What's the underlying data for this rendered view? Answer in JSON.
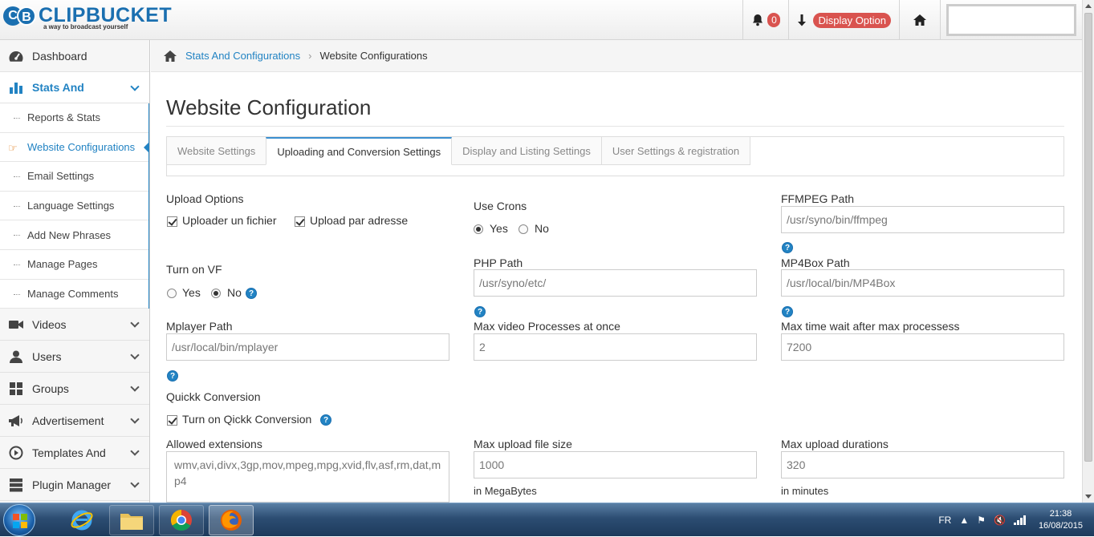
{
  "header": {
    "logo_letters": [
      "C",
      "B"
    ],
    "logo_name": "CLIPBUCKET",
    "logo_tagline": "a way to broadcast yourself",
    "notif_count": "0",
    "display_option": "Display Option"
  },
  "sidebar": {
    "items": [
      {
        "label": "Dashboard",
        "icon": "dashboard-icon"
      },
      {
        "label": "Stats And",
        "icon": "bar-chart-icon"
      },
      {
        "label": "Videos",
        "icon": "video-camera-icon"
      },
      {
        "label": "Users",
        "icon": "user-icon"
      },
      {
        "label": "Groups",
        "icon": "grid-icon"
      },
      {
        "label": "Advertisement",
        "icon": "megaphone-icon"
      },
      {
        "label": "Templates And",
        "icon": "play-circle-icon"
      },
      {
        "label": "Plugin Manager",
        "icon": "server-icon"
      }
    ],
    "submenu": [
      "Reports & Stats",
      "Website Configurations",
      "Email Settings",
      "Language Settings",
      "Add New Phrases",
      "Manage Pages",
      "Manage Comments"
    ]
  },
  "breadcrumb": {
    "link": "Stats And Configurations",
    "current": "Website Configurations"
  },
  "page": {
    "title": "Website Configuration",
    "tabs": [
      "Website Settings",
      "Uploading and Conversion Settings",
      "Display and Listing Settings",
      "User Settings & registration"
    ],
    "active_tab": "Uploading and Conversion Settings"
  },
  "form": {
    "upload_options": {
      "label": "Upload Options",
      "opt1": "Uploader un fichier",
      "opt2": "Upload par adresse"
    },
    "use_crons": {
      "label": "Use Crons",
      "yes": "Yes",
      "no": "No",
      "selected": "Yes"
    },
    "ffmpeg": {
      "label": "FFMPEG Path",
      "value": "/usr/syno/bin/ffmpeg"
    },
    "turn_on_vf": {
      "label": "Turn on VF",
      "yes": "Yes",
      "no": "No",
      "selected": "No"
    },
    "php_path": {
      "label": "PHP Path",
      "value": "/usr/syno/etc/"
    },
    "mp4box": {
      "label": "MP4Box Path",
      "value": "/usr/local/bin/MP4Box"
    },
    "mplayer": {
      "label": "Mplayer Path",
      "value": "/usr/local/bin/mplayer"
    },
    "max_video_processes": {
      "label": "Max video Processes at once",
      "value": "2"
    },
    "max_time_wait": {
      "label": "Max time wait after max processess",
      "value": "7200"
    },
    "quick_conversion": {
      "label": "Quickk Conversion",
      "opt": "Turn on Qickk Conversion"
    },
    "allowed_ext": {
      "label": "Allowed extensions",
      "value": "wmv,avi,divx,3gp,mov,mpeg,mpg,xvid,flv,asf,rm,dat,mp4"
    },
    "max_upload_size": {
      "label": "Max upload file size",
      "value": "1000",
      "unit": "in MegaBytes"
    },
    "max_upload_duration": {
      "label": "Max upload durations",
      "value": "320",
      "unit": "in minutes"
    },
    "help_glyph": "?"
  },
  "taskbar": {
    "lang": "FR",
    "time": "21:38",
    "date": "16/08/2015"
  },
  "colors": {
    "accent": "#2283c3",
    "badge_red": "#d9534f"
  }
}
